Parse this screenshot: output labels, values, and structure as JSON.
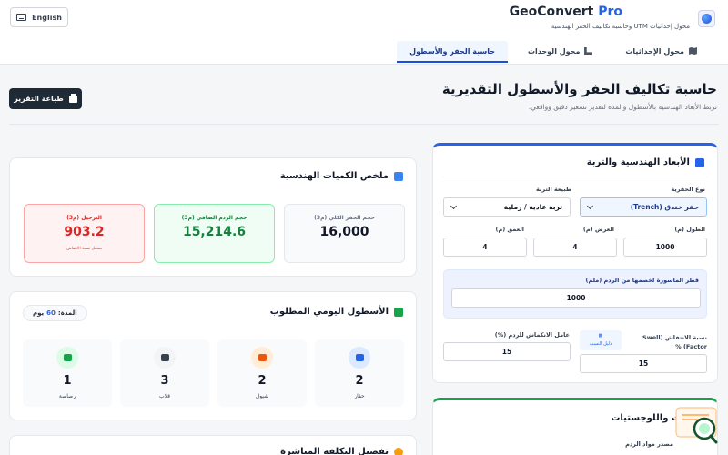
{
  "header": {
    "brand": "GeoConvert",
    "brand_suffix": "Pro",
    "subtitle": "محول إحداثيات UTM وحاسبة تكاليف الحفر الهندسية",
    "language_button": "English",
    "tabs": [
      {
        "label": "محول الإحداثيات",
        "icon": "map-icon",
        "active": false
      },
      {
        "label": "محول الوحدات",
        "icon": "ruler-icon",
        "active": false
      },
      {
        "label": "حاسبة الحفر والأسطول",
        "icon": "",
        "active": true
      }
    ]
  },
  "page": {
    "title": "حاسبة تكاليف الحفر والأسطول التقديرية",
    "description": "تربط الأبعاد الهندسية بالأسطول والمدة لتقدير تسعير دقيق وواقعي.",
    "print_button": "طباعة التقرير"
  },
  "summary": {
    "title": "ملخص الكميات الهندسية",
    "boxes": [
      {
        "label": "حجم الحفر الكلي (م3)",
        "value": "16,000"
      },
      {
        "label": "حجم الردم الصافي (م3)",
        "value": "15,214.6"
      },
      {
        "label": "الترحيل (م3)",
        "value": "903.2",
        "note": "يشمل نسبة الانتفاش"
      }
    ]
  },
  "fleet": {
    "title": "الأسطول اليومي المطلوب",
    "duration_label": "المدة:",
    "duration_value": "60",
    "duration_unit": "يوم",
    "items": [
      {
        "name": "حفار",
        "count": "2",
        "icon": "bucket-icon"
      },
      {
        "name": "شيول",
        "count": "2",
        "icon": "loader-icon"
      },
      {
        "name": "قلاب",
        "count": "3",
        "icon": "truck-icon"
      },
      {
        "name": "رصاصة",
        "count": "1",
        "icon": "roller-icon"
      }
    ]
  },
  "cost": {
    "title": "تفصيل التكلفة المباشرة"
  },
  "dimensions": {
    "title": "الأبعاد الهندسية والتربة",
    "excavation_type_label": "نوع الحفرية",
    "excavation_type_value": "حفر خندق (Trench)",
    "soil_type_label": "طبيعة التربة",
    "soil_type_value": "تربة عادية / رملية",
    "length_label": "الطول (م)",
    "length_value": "1000",
    "width_label": "العرض (م)",
    "width_value": "4",
    "depth_label": "العمق (م)",
    "depth_value": "4",
    "pipe_label": "قطر الماسورة لخصمها من الردم (ملم)",
    "pipe_value": "1000",
    "swell_label": "نسبة الانتفاش (Swell Factor) %",
    "swell_value": "15",
    "shrink_label": "عامل الانكماش للردم (%)",
    "shrink_value": "15",
    "guide_label": "دليل النسب"
  },
  "logistics": {
    "title": "الرديات واللوجستيات",
    "fill_source_label": "مصدر مواد الردم"
  },
  "colors": {
    "primary": "#2563eb",
    "dark": "#1f2a37",
    "success": "#16a34a",
    "danger": "#dc2626"
  }
}
